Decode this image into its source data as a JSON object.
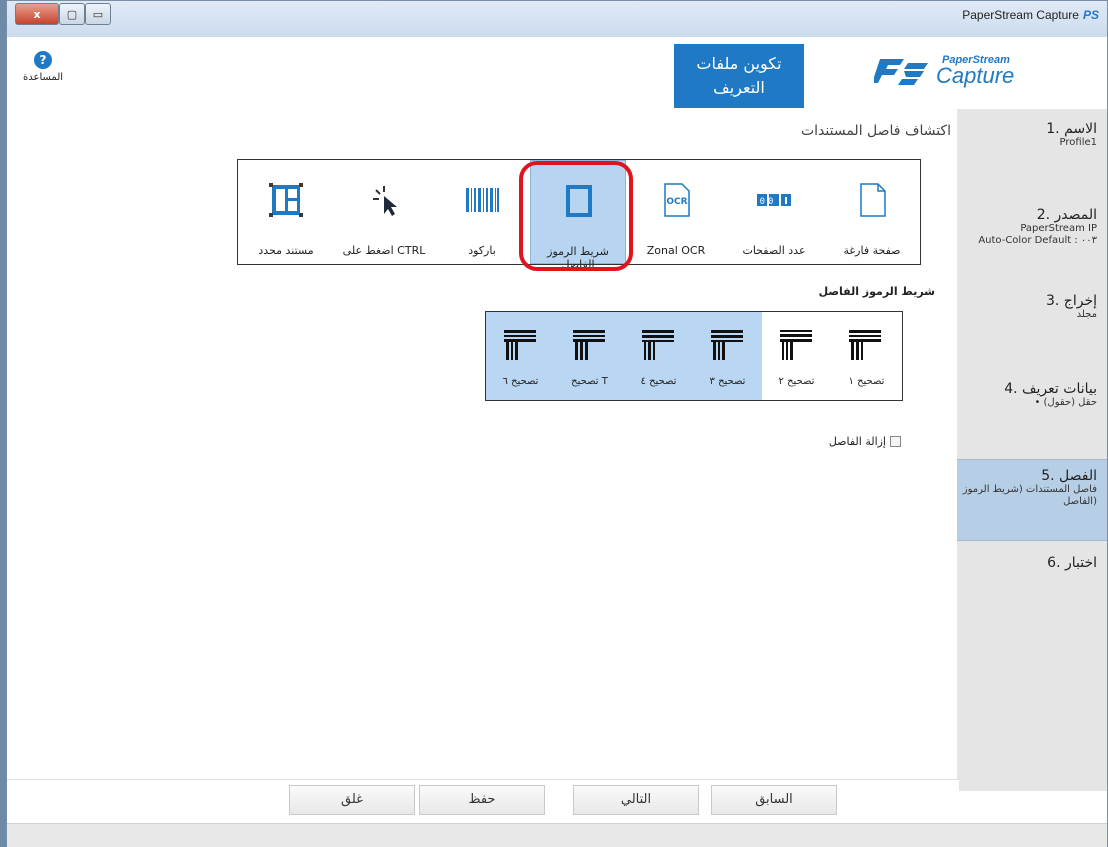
{
  "window": {
    "title": "PaperStream Capture",
    "close": "x",
    "maximize": "▢",
    "minimize": "▭"
  },
  "header": {
    "help_label": "المساعدة",
    "help_symbol": "?",
    "tab_line1": "تكوين ملفات",
    "tab_line2": "التعريف",
    "logo_small": "PaperStream",
    "logo_big": "Capture",
    "logo_mark": "PS"
  },
  "sidebar": {
    "steps": [
      {
        "title": "1. الاسم",
        "sub1": "Profile1",
        "sub2": ""
      },
      {
        "title": "2. المصدر",
        "sub1": "PaperStream IP",
        "sub2": "Auto-Color Default : ۰۰۳"
      },
      {
        "title": "3. إخراج",
        "sub1": "مجلد",
        "sub2": ""
      },
      {
        "title": "4. بيانات تعريف",
        "sub1": "• حقل (حقول)",
        "sub2": ""
      },
      {
        "title": "5. الفصل",
        "sub1": "فاصل المستندات (شريط الرموز",
        "sub2": "الفاصل)"
      },
      {
        "title": "6. اختبار",
        "sub1": "",
        "sub2": ""
      }
    ]
  },
  "main": {
    "section_title": "اكتشاف فاصل المستندات",
    "separators": [
      {
        "label": "مستند محدد"
      },
      {
        "label": "اضغط على CTRL"
      },
      {
        "label": "باركود"
      },
      {
        "label": "شريط الرموز الفاصل"
      },
      {
        "label": "Zonal OCR"
      },
      {
        "label": "عدد الصفحات"
      },
      {
        "label": "صفحة فارغة"
      }
    ],
    "page_count_digits": "00",
    "ocr_text": "OCR",
    "patch_title": "شريط الرموز الفاصل",
    "patches": [
      {
        "label": "تصحيح ٦"
      },
      {
        "label": "تصحيح T"
      },
      {
        "label": "تصحيح ٤"
      },
      {
        "label": "تصحيح ٣"
      },
      {
        "label": "تصحيح ٢"
      },
      {
        "label": "تصحيح ١"
      }
    ],
    "remove_separator": "إزالة الفاصل"
  },
  "footer": {
    "close": "غلق",
    "save": "حفظ",
    "next": "التالي",
    "back": "السابق"
  },
  "colors": {
    "accent": "#1f79c4",
    "highlight": "#e0141e",
    "selected": "#b7d4f0",
    "sidebar": "#e5e5e5"
  }
}
